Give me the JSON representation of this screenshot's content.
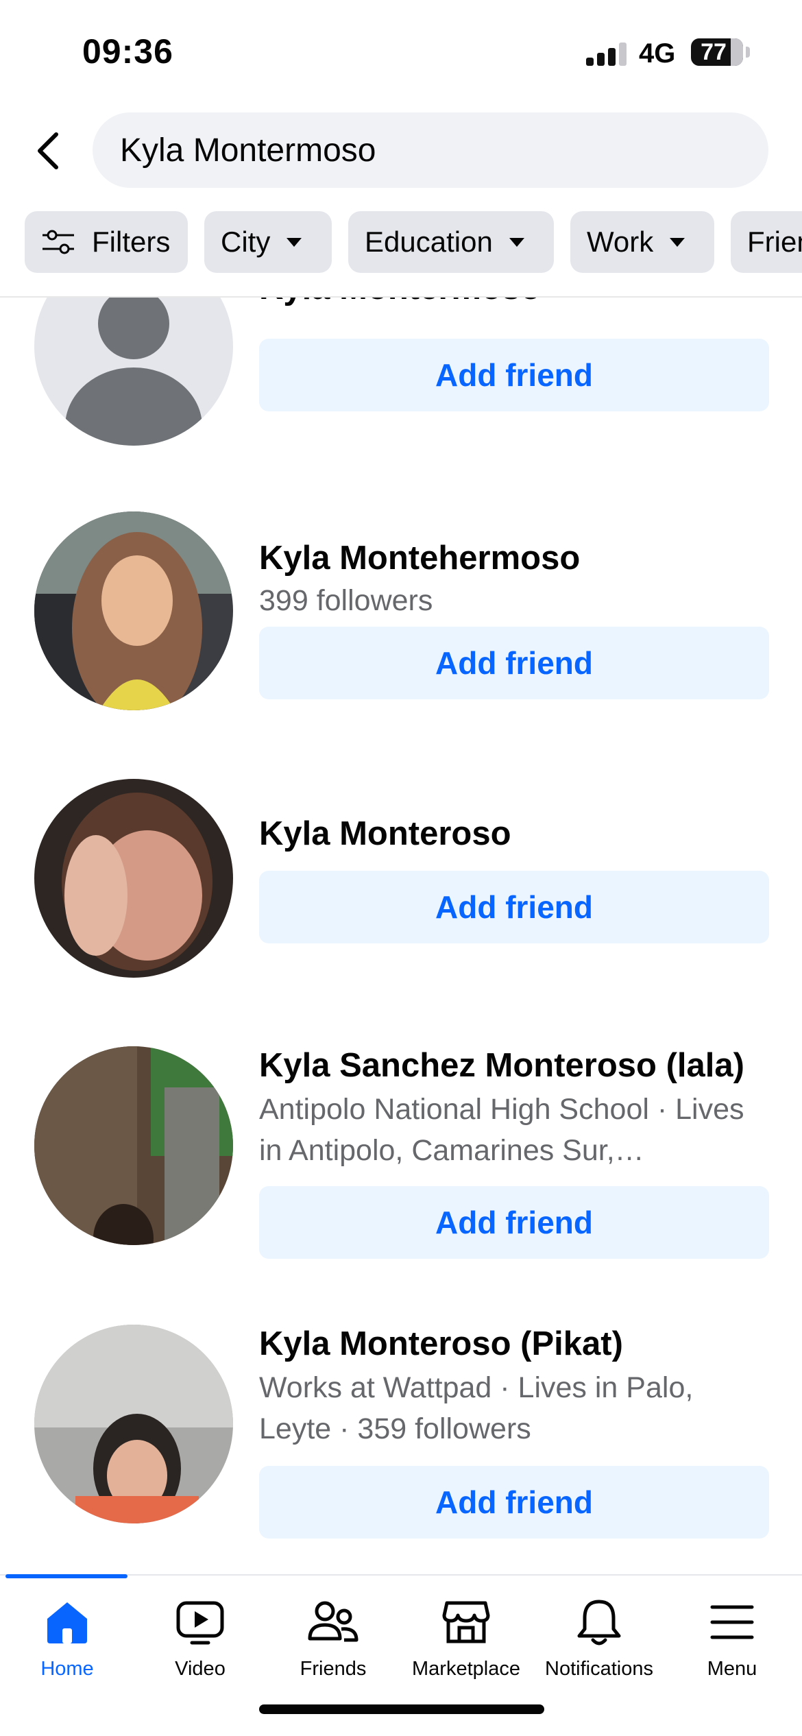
{
  "status_bar": {
    "time": "09:36",
    "network": "4G",
    "battery": "77"
  },
  "search": {
    "query": "Kyla Montermoso",
    "back_icon": "chevron-left-icon"
  },
  "filters": [
    {
      "label": "Filters",
      "icon": "sliders-icon"
    },
    {
      "label": "City",
      "icon": "caret-down-icon"
    },
    {
      "label": "Education",
      "icon": "caret-down-icon"
    },
    {
      "label": "Work",
      "icon": "caret-down-icon"
    },
    {
      "label": "Friends",
      "icon": "caret-down-icon"
    }
  ],
  "results": [
    {
      "name": "Kyla Montermoso",
      "meta": "",
      "button": "Add friend",
      "avatar": "default-profile-silhouette"
    },
    {
      "name": "Kyla Montehermoso",
      "meta": "399 followers",
      "button": "Add friend",
      "avatar": "profile-photo"
    },
    {
      "name": "Kyla Monteroso",
      "meta": "",
      "button": "Add friend",
      "avatar": "profile-photo"
    },
    {
      "name": "Kyla Sanchez Monteroso (lala)",
      "meta": "Antipolo National High School · Lives in Antipolo, Camarines Sur,…",
      "button": "Add friend",
      "avatar": "profile-photo"
    },
    {
      "name": "Kyla Monteroso (Pikat)",
      "meta": "Works at Wattpad · Lives in Palo, Leyte · 359 followers",
      "button": "Add friend",
      "avatar": "profile-photo"
    }
  ],
  "tabs": [
    {
      "label": "Home",
      "icon": "home-icon",
      "active": true
    },
    {
      "label": "Video",
      "icon": "video-icon",
      "active": false
    },
    {
      "label": "Friends",
      "icon": "friends-icon",
      "active": false
    },
    {
      "label": "Marketplace",
      "icon": "marketplace-icon",
      "active": false
    },
    {
      "label": "Notifications",
      "icon": "bell-icon",
      "active": false
    },
    {
      "label": "Menu",
      "icon": "hamburger-icon",
      "active": false
    }
  ],
  "colors": {
    "accent": "#0866ff",
    "button_bg": "#ebf5ff",
    "chip_bg": "#e4e6eb",
    "secondary_text": "#65676b"
  }
}
